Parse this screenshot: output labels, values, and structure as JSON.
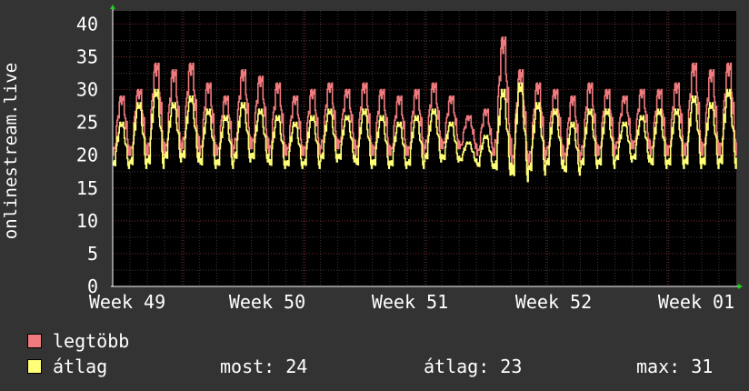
{
  "chart_data": {
    "type": "line",
    "ylabel": "onlinestream.live",
    "ylim": [
      0,
      42
    ],
    "yticks": [
      0,
      5,
      10,
      15,
      20,
      25,
      30,
      35,
      40
    ],
    "xlabels": [
      "Week 49",
      "Week 50",
      "Week 51",
      "Week 52",
      "Week 01"
    ],
    "grid": true,
    "background": "#000000",
    "grid_major_color": "#7a2a2a",
    "grid_minor_color": "#3a3a3a",
    "daily_points": 24,
    "series": [
      {
        "name": "legtöbb",
        "color": "#f07b7e",
        "daily_min": [
          20,
          20,
          20,
          20,
          21,
          20,
          20,
          21,
          21,
          20,
          20,
          20,
          21,
          21,
          20,
          20,
          20,
          20,
          21,
          21,
          21,
          20,
          20,
          18,
          19,
          20,
          19,
          20,
          20,
          21,
          21,
          20,
          20,
          20,
          20,
          20
        ],
        "daily_max": [
          29,
          30,
          34,
          33,
          34,
          31,
          29,
          33,
          32,
          31,
          29,
          30,
          31,
          30,
          31,
          30,
          29,
          30,
          31,
          29,
          26,
          27,
          38,
          33,
          31,
          30,
          29,
          31,
          30,
          29,
          30,
          30,
          31,
          34,
          33,
          34
        ]
      },
      {
        "name": "átlag",
        "color": "#ffff77",
        "daily_min": [
          18,
          18,
          18,
          19,
          19,
          18,
          18,
          19,
          19,
          18,
          18,
          18,
          19,
          19,
          18,
          18,
          18,
          18,
          19,
          19,
          19,
          18,
          17,
          16,
          17,
          18,
          17,
          18,
          18,
          19,
          19,
          18,
          18,
          18,
          18,
          18
        ],
        "daily_max": [
          25,
          28,
          30,
          28,
          29,
          27,
          26,
          28,
          27,
          26,
          25,
          26,
          27,
          26,
          27,
          26,
          25,
          26,
          27,
          25,
          22,
          23,
          30,
          31,
          28,
          27,
          25,
          27,
          27,
          25,
          26,
          27,
          27,
          29,
          28,
          30
        ]
      }
    ]
  },
  "legend": {
    "items": [
      {
        "label": "legtöbb",
        "color": "#f07b7e"
      },
      {
        "label": "átlag",
        "color": "#ffff77"
      }
    ],
    "stats": {
      "now": "most: 24",
      "avg": "átlag: 23",
      "max": "max: 31"
    }
  }
}
